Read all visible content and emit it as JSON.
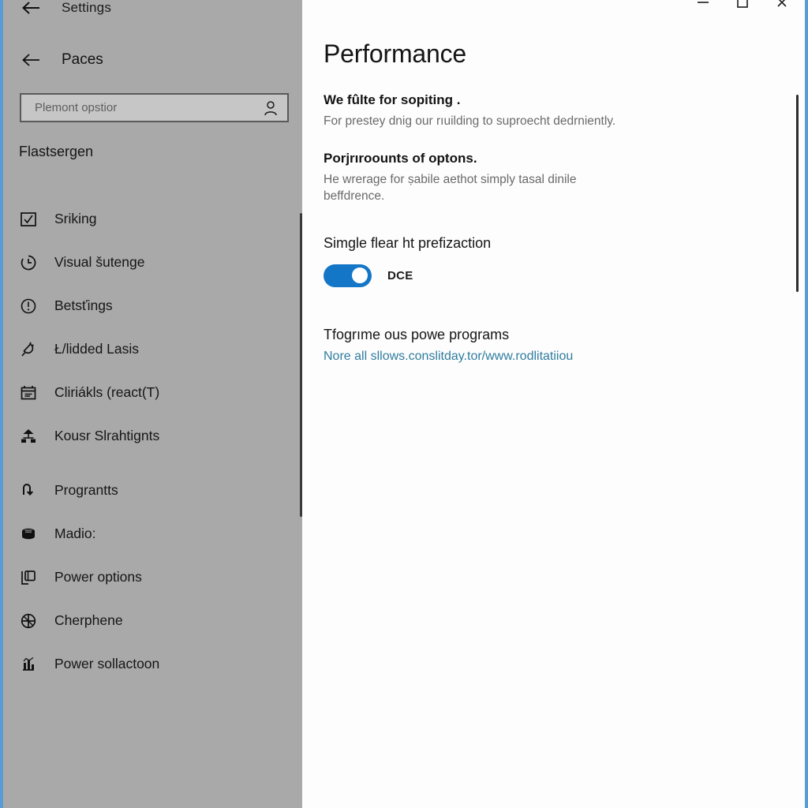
{
  "window": {
    "title": "Settings",
    "controls": [
      {
        "name": "minimize",
        "glyph": "─"
      },
      {
        "name": "maximize",
        "glyph": "□"
      },
      {
        "name": "close",
        "glyph": "✕"
      }
    ],
    "accent_border_color": "#5b9bd5"
  },
  "sidebar": {
    "back_label": "Paces",
    "background_color": "#a9a9a9",
    "search": {
      "placeholder": "Plemont opstior",
      "value": "",
      "icon": "person-icon"
    },
    "section_title": "Flastsergen",
    "items": [
      {
        "label": "Sriking",
        "icon": "checkbox-icon"
      },
      {
        "label": "Visual šutenge",
        "icon": "history-clock-icon"
      },
      {
        "label": "Betsťings",
        "icon": "info-circle-icon"
      },
      {
        "label": "Ł/lidded Lasis",
        "icon": "plug-icon"
      },
      {
        "label": "Cliriákls (react(T)",
        "icon": "calendar-icon"
      },
      {
        "label": "Kousr Slrahtignts",
        "icon": "network-share-icon"
      },
      {
        "label": "Prograntts",
        "icon": "arrow-turn-icon"
      },
      {
        "label": "Madio:",
        "icon": "database-icon"
      },
      {
        "label": "Power options",
        "icon": "window-icon"
      },
      {
        "label": "Cherphene",
        "icon": "globe-icon"
      },
      {
        "label": "Power sollactoon",
        "icon": "analytics-icon"
      }
    ]
  },
  "main": {
    "page_title": "Performance",
    "sections": [
      {
        "heading": "We fûlte for sopiting .",
        "body": "For prestey dnig our rıuilding to suproecht dedrniently."
      },
      {
        "heading": "Porjrıroounts of optons.",
        "body": "He wrerage for ṣabile aethot simply tasal dinile beffdrence."
      }
    ],
    "toggle": {
      "label": "Simgle flear ht prefizaction",
      "state_text": "DCE",
      "checked": true,
      "on_color": "#1476c6"
    },
    "link_block": {
      "heading": "Tfogrıme ous powe programs",
      "url_text": "Nore all sllows.conslitday.tor/www.rodlitatiiou",
      "link_color": "#2f7c9e"
    }
  }
}
